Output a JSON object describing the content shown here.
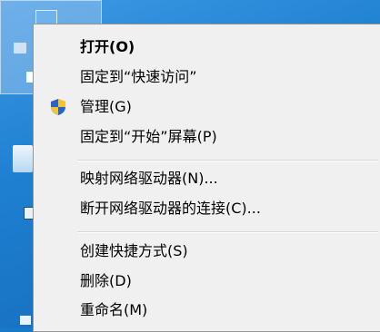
{
  "desktop": {
    "background_color": "#1e7fd1"
  },
  "context_menu": {
    "items": [
      {
        "label": "打开(O)",
        "bold": true
      },
      {
        "label": "固定到“快速访问”"
      },
      {
        "label": "管理(G)",
        "icon": "uac-shield-icon"
      },
      {
        "label": "固定到“开始”屏幕(P)"
      },
      {
        "label": "映射网络驱动器(N)..."
      },
      {
        "label": "断开网络驱动器的连接(C)..."
      },
      {
        "label": "创建快捷方式(S)"
      },
      {
        "label": "删除(D)"
      },
      {
        "label": "重命名(M)"
      }
    ],
    "shield_colors": {
      "blue": "#2a63c8",
      "yellow": "#f2c431"
    }
  }
}
